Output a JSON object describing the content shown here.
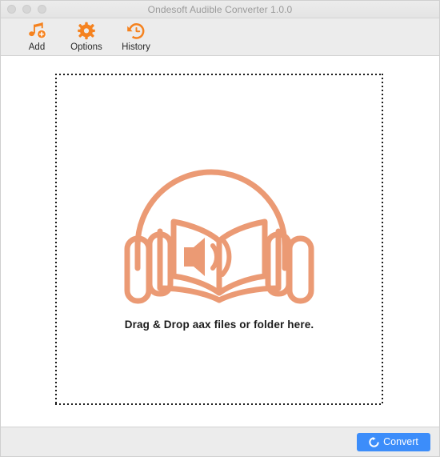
{
  "window": {
    "title": "Ondesoft Audible Converter 1.0.0",
    "traffic_lights": [
      {
        "name": "close",
        "color": "#d6d6d6"
      },
      {
        "name": "minimize",
        "color": "#d6d6d6"
      },
      {
        "name": "zoom",
        "color": "#d6d6d6"
      }
    ]
  },
  "toolbar": {
    "items": [
      {
        "label": "Add",
        "icon": "music-note-add-icon"
      },
      {
        "label": "Options",
        "icon": "gear-icon"
      },
      {
        "label": "History",
        "icon": "clock-history-icon"
      }
    ]
  },
  "drop_zone": {
    "illustration_icon": "audiobook-headphones-icon",
    "hint_text": "Drag & Drop aax files or folder here."
  },
  "bottom_bar": {
    "convert_label": "Convert",
    "convert_icon": "refresh-circle-icon"
  },
  "colors": {
    "accent_orange": "#f5821f",
    "illustration_salmon": "#eb9a74",
    "convert_blue": "#3c8dfa",
    "toolbar_gray": "#ececec",
    "title_text": "#9a9a9a",
    "body_text": "#1b1b1b"
  }
}
